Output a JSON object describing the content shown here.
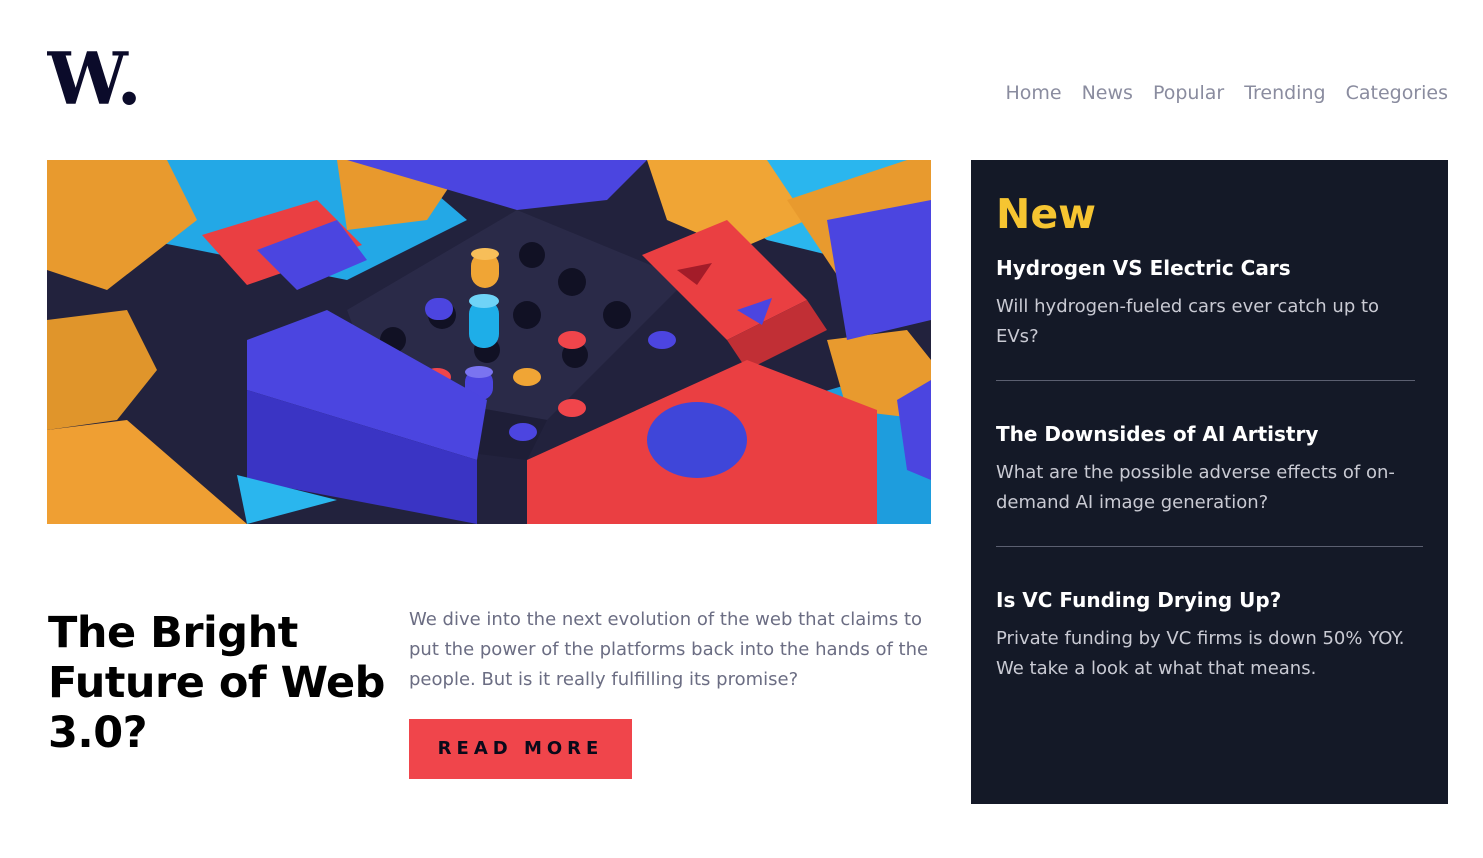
{
  "logo": {
    "text": "W."
  },
  "nav": {
    "items": [
      "Home",
      "News",
      "Popular",
      "Trending",
      "Categories"
    ]
  },
  "hero": {
    "image_alt": "colorful abstract geometric blocks",
    "headline": "The Bright Future of Web 3.0?",
    "summary": "We dive into the next evolution of the web that claims to put the power of the platforms back into the hands of the people. But is it really fulfilling its promise?",
    "cta_label": "READ MORE"
  },
  "sidebar": {
    "heading": "New",
    "items": [
      {
        "title": "Hydrogen VS Electric Cars",
        "desc": "Will hydrogen-fueled cars ever catch up to EVs?"
      },
      {
        "title": "The Downsides of AI Artistry",
        "desc": "What are the possible adverse effects of on-demand AI image generation?"
      },
      {
        "title": "Is VC Funding Drying Up?",
        "desc": "Private funding by VC firms is down 50% YOY. We take a look at what that means."
      }
    ]
  },
  "colors": {
    "accent": "#f0454b",
    "sidebar_bg": "#141927",
    "sidebar_heading": "#f6c531",
    "nav_text": "#8a8c9f"
  }
}
